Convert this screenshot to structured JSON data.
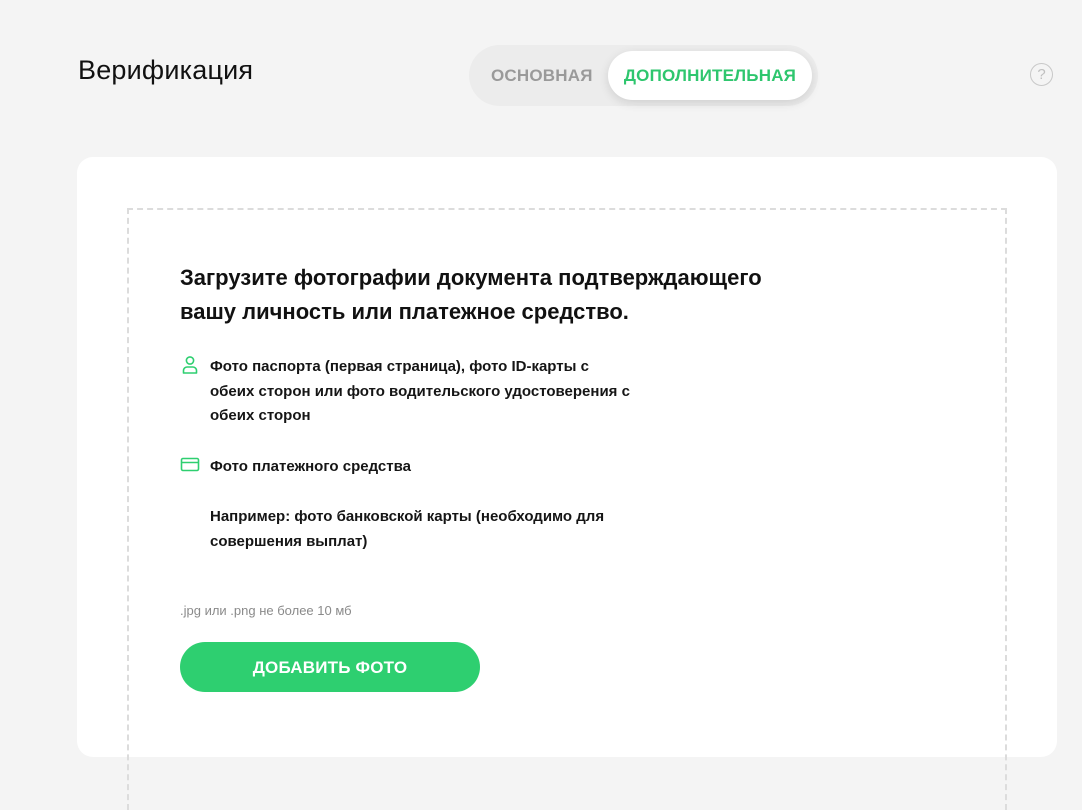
{
  "header": {
    "title": "Верификация",
    "help_symbol": "?"
  },
  "tabs": [
    {
      "label": "ОСНОВНАЯ",
      "active": false
    },
    {
      "label": "ДОПОЛНИТЕЛЬНАЯ",
      "active": true
    }
  ],
  "upload": {
    "heading": "Загрузите фотографии документа подтверждающего вашу личность или платежное средство.",
    "requirements": [
      {
        "icon": "user-icon",
        "text": "Фото паспорта (первая страница), фото ID-карты с обеих сторон или фото водительского удостоверения с обеих сторон"
      },
      {
        "icon": "card-icon",
        "text": "Фото платежного средства"
      },
      {
        "icon": "",
        "text": "Например: фото банковской карты (необходимо для совершения выплат)"
      }
    ],
    "file_hint": ".jpg или .png не более 10 мб",
    "add_button_label": "ДОБАВИТЬ ФОТО"
  },
  "colors": {
    "accent": "#2ecf70",
    "tab_active_text": "#2ec66e",
    "background": "#f4f4f4"
  }
}
